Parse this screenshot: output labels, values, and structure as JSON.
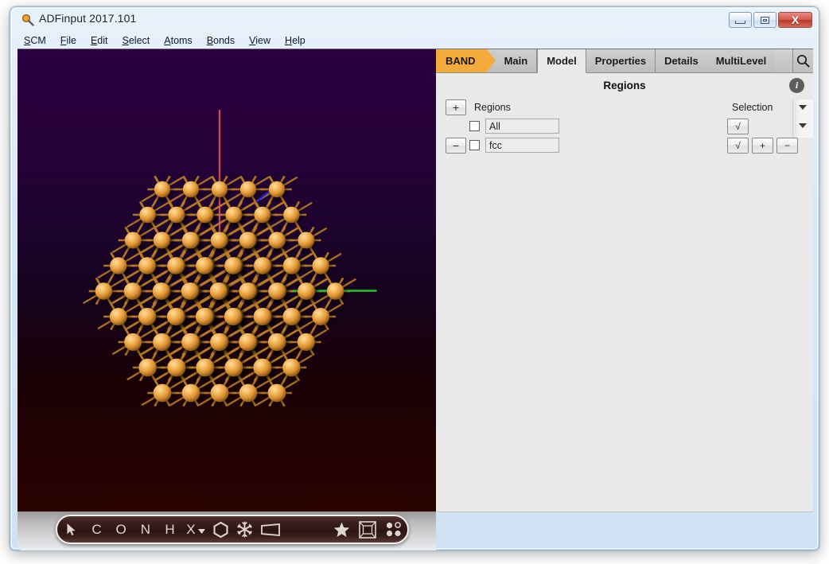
{
  "window": {
    "title": "ADFinput 2017.101",
    "icon": "magnifier-icon",
    "minimize_label": "Minimize",
    "maximize_label": "Maximize",
    "close_label": "X"
  },
  "menubar": {
    "items": [
      {
        "label": "SCM",
        "accel": "S"
      },
      {
        "label": "File",
        "accel": "F"
      },
      {
        "label": "Edit",
        "accel": "E"
      },
      {
        "label": "Select",
        "accel": "S"
      },
      {
        "label": "Atoms",
        "accel": "A"
      },
      {
        "label": "Bonds",
        "accel": "B"
      },
      {
        "label": "View",
        "accel": "V"
      },
      {
        "label": "Help",
        "accel": "H"
      }
    ]
  },
  "tabs": {
    "module": "BAND",
    "items": [
      {
        "label": "Main",
        "active": false
      },
      {
        "label": "Model",
        "active": true
      },
      {
        "label": "Properties",
        "active": false
      },
      {
        "label": "Details",
        "active": false
      },
      {
        "label": "MultiLevel",
        "active": false
      }
    ],
    "search_icon": "search-icon"
  },
  "panel": {
    "title": "Regions",
    "info_icon": "i",
    "add_button": "+",
    "remove_button": "−",
    "regions_header": "Regions",
    "selection_header": "Selection",
    "rows": [
      {
        "checked": false,
        "name": "All",
        "select_check": "√",
        "has_plus": false,
        "has_minus": false,
        "has_remove": false
      },
      {
        "checked": false,
        "name": "fcc",
        "select_check": "√",
        "plus": "+",
        "minus": "−",
        "has_plus": true,
        "has_minus": true,
        "has_remove": true,
        "remove_button": "−"
      }
    ]
  },
  "atom_toolbar": {
    "tools": [
      {
        "name": "cursor-select-tool",
        "glyph": "arrow"
      },
      {
        "name": "carbon-tool",
        "glyph": "C"
      },
      {
        "name": "oxygen-tool",
        "glyph": "O"
      },
      {
        "name": "nitrogen-tool",
        "glyph": "N"
      },
      {
        "name": "hydrogen-tool",
        "glyph": "H"
      },
      {
        "name": "element-picker-tool",
        "glyph": "X"
      },
      {
        "name": "benzene-ring-tool",
        "glyph": "hexagon"
      },
      {
        "name": "fragment-tool",
        "glyph": "snowflake"
      },
      {
        "name": "plane-tool",
        "glyph": "parallelogram"
      },
      {
        "name": "favorites-tool",
        "glyph": "star"
      },
      {
        "name": "unit-cell-tool",
        "glyph": "box"
      },
      {
        "name": "lattice-points-tool",
        "glyph": "dots"
      }
    ]
  },
  "viewport": {
    "background_top": "#2b0140",
    "background_bottom": "#2a0302",
    "atom_color": "#e9a13c",
    "bond_color": "#b97c22",
    "axis_a_color": "#e05a5a",
    "axis_b_color": "#23c423",
    "axis_c_color": "#2a2ad6",
    "structure": "fcc lattice slab"
  },
  "colors": {
    "accent": "#f3ab3c",
    "panel_bg": "#e9e9e9",
    "tab_gray": "#c2c2c2",
    "title_bg": "#d7e8f7"
  }
}
